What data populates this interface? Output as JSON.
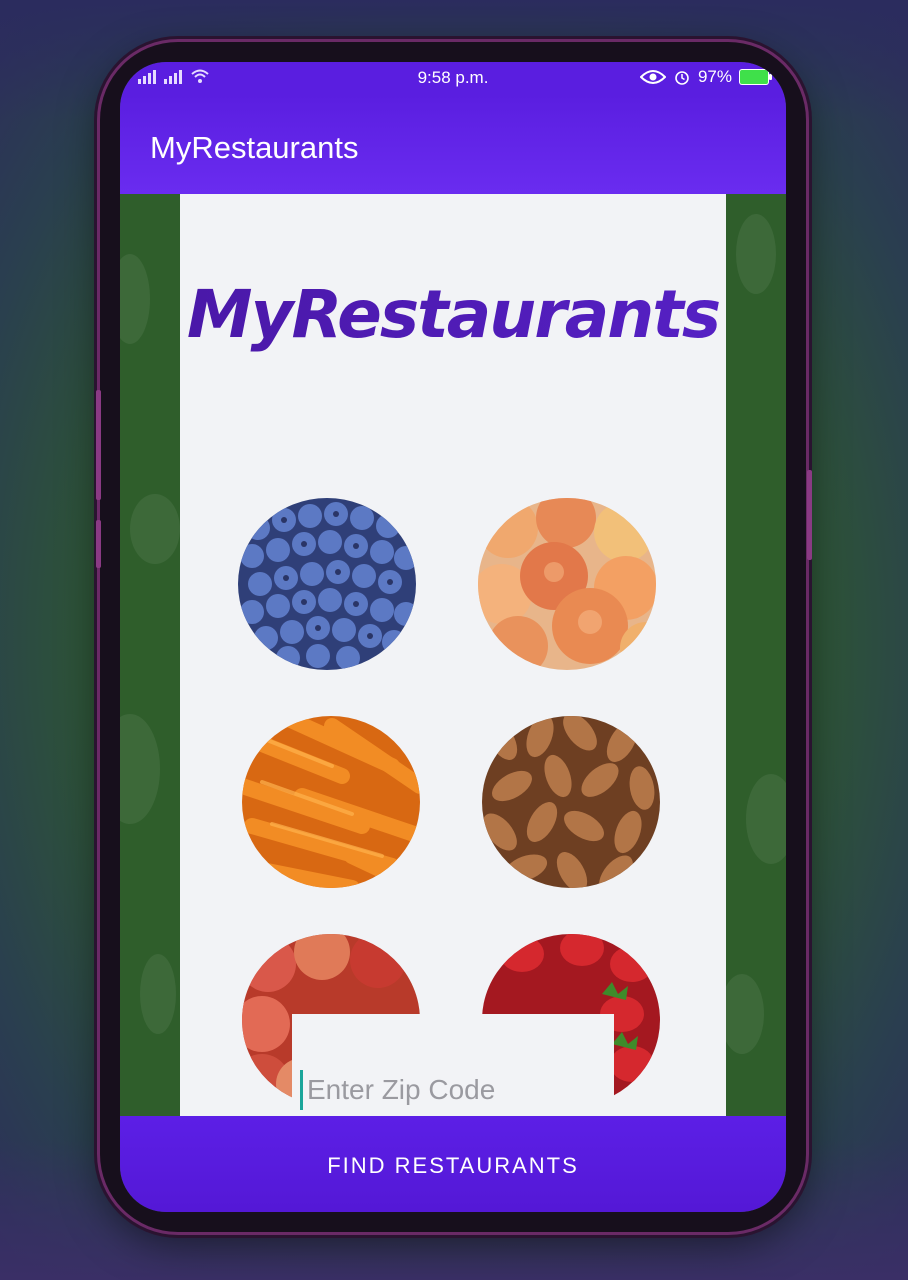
{
  "status_bar": {
    "time": "9:58 p.m.",
    "battery": "97%",
    "icons": [
      "signal-icon",
      "wifi-icon",
      "eye-icon",
      "alarm-icon",
      "battery-icon"
    ]
  },
  "app_bar": {
    "title": "MyRestaurants"
  },
  "hero": {
    "title": "MyRestaurants"
  },
  "food_images": [
    "blueberries",
    "peaches",
    "carrots",
    "almonds",
    "apples",
    "strawberries"
  ],
  "zip": {
    "placeholder": "Enter Zip Code",
    "value": ""
  },
  "actions": {
    "find_label": "FIND RESTAURANTS"
  },
  "colors": {
    "primary": "#5a1ee0",
    "title": "#4a1fb0",
    "background_green": "#2f5e2b"
  }
}
